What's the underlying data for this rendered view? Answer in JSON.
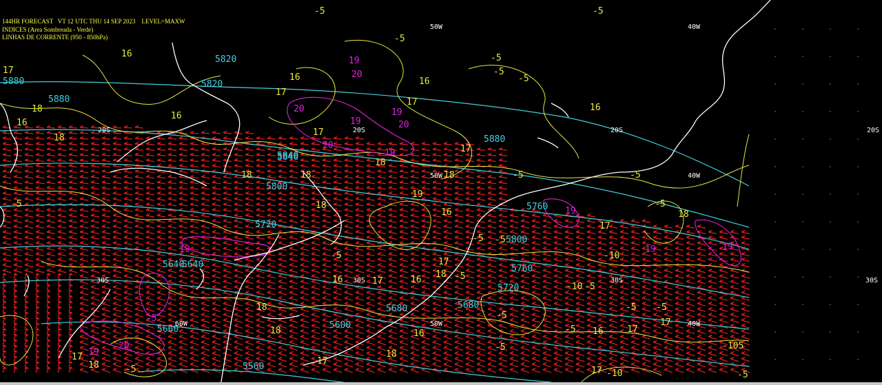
{
  "header": {
    "line1": "144HR FORECAST   VT 12 UTC THU 14 SEP 2023    LEVEL=MAXW",
    "line2": "INDICES (Area Sombreada - Verde)",
    "line3": "LINHAS DE CORRENTE (950 - 850hPa)"
  },
  "grid_labels": {
    "lon_50w_top": "50W",
    "lon_40w_top": "40W",
    "lat_20s": "20S",
    "lat_30s": "30S",
    "lon_40w_mid": "40W",
    "lon_50w_mid": "50W",
    "lon_60w_bot": "60W",
    "lon_50w_bot": "50W",
    "lon_40w_bot": "40W"
  },
  "colors": {
    "background": "#000000",
    "coast": "#ffffff",
    "wind_barbs": "#ff2020",
    "thickness": "#40d0e0",
    "index_yellow": "#e8e840",
    "index_magenta": "#e020e0",
    "header": "#ffff40"
  },
  "labels": {
    "yellow": [
      "-5",
      "-5",
      "-5",
      "-5",
      "-5",
      "-5",
      "16",
      "16",
      "16",
      "16",
      "17",
      "17",
      "17",
      "18",
      "18",
      "18",
      "18",
      "18",
      "18",
      "16",
      "16",
      "17",
      "19",
      "18",
      "17",
      "16",
      "-5",
      "-5",
      "-5",
      "-5",
      "-10",
      "-5",
      "18",
      "16",
      "17",
      "16",
      "18",
      "-5",
      "-5",
      "-10",
      "-5",
      "16",
      "-5",
      "-5",
      "17",
      "17",
      "18",
      "17",
      "-5",
      "-5",
      "17",
      "18",
      "16",
      "17",
      "-5",
      "-105",
      "-5",
      "-5",
      "-10",
      "17",
      "18",
      "17",
      "18",
      "-5"
    ],
    "cyan": [
      "5880",
      "5880",
      "5820",
      "5840",
      "5800",
      "5760",
      "5720",
      "5680",
      "5640",
      "5600",
      "5560",
      "5880",
      "5840",
      "5820",
      "5800",
      "5760",
      "5720",
      "5680",
      "5640",
      "5660"
    ],
    "magenta": [
      "19",
      "19",
      "20",
      "20",
      "20",
      "19",
      "19",
      "20",
      "19",
      "19",
      "19",
      "20",
      "-5",
      "19",
      "19"
    ]
  }
}
